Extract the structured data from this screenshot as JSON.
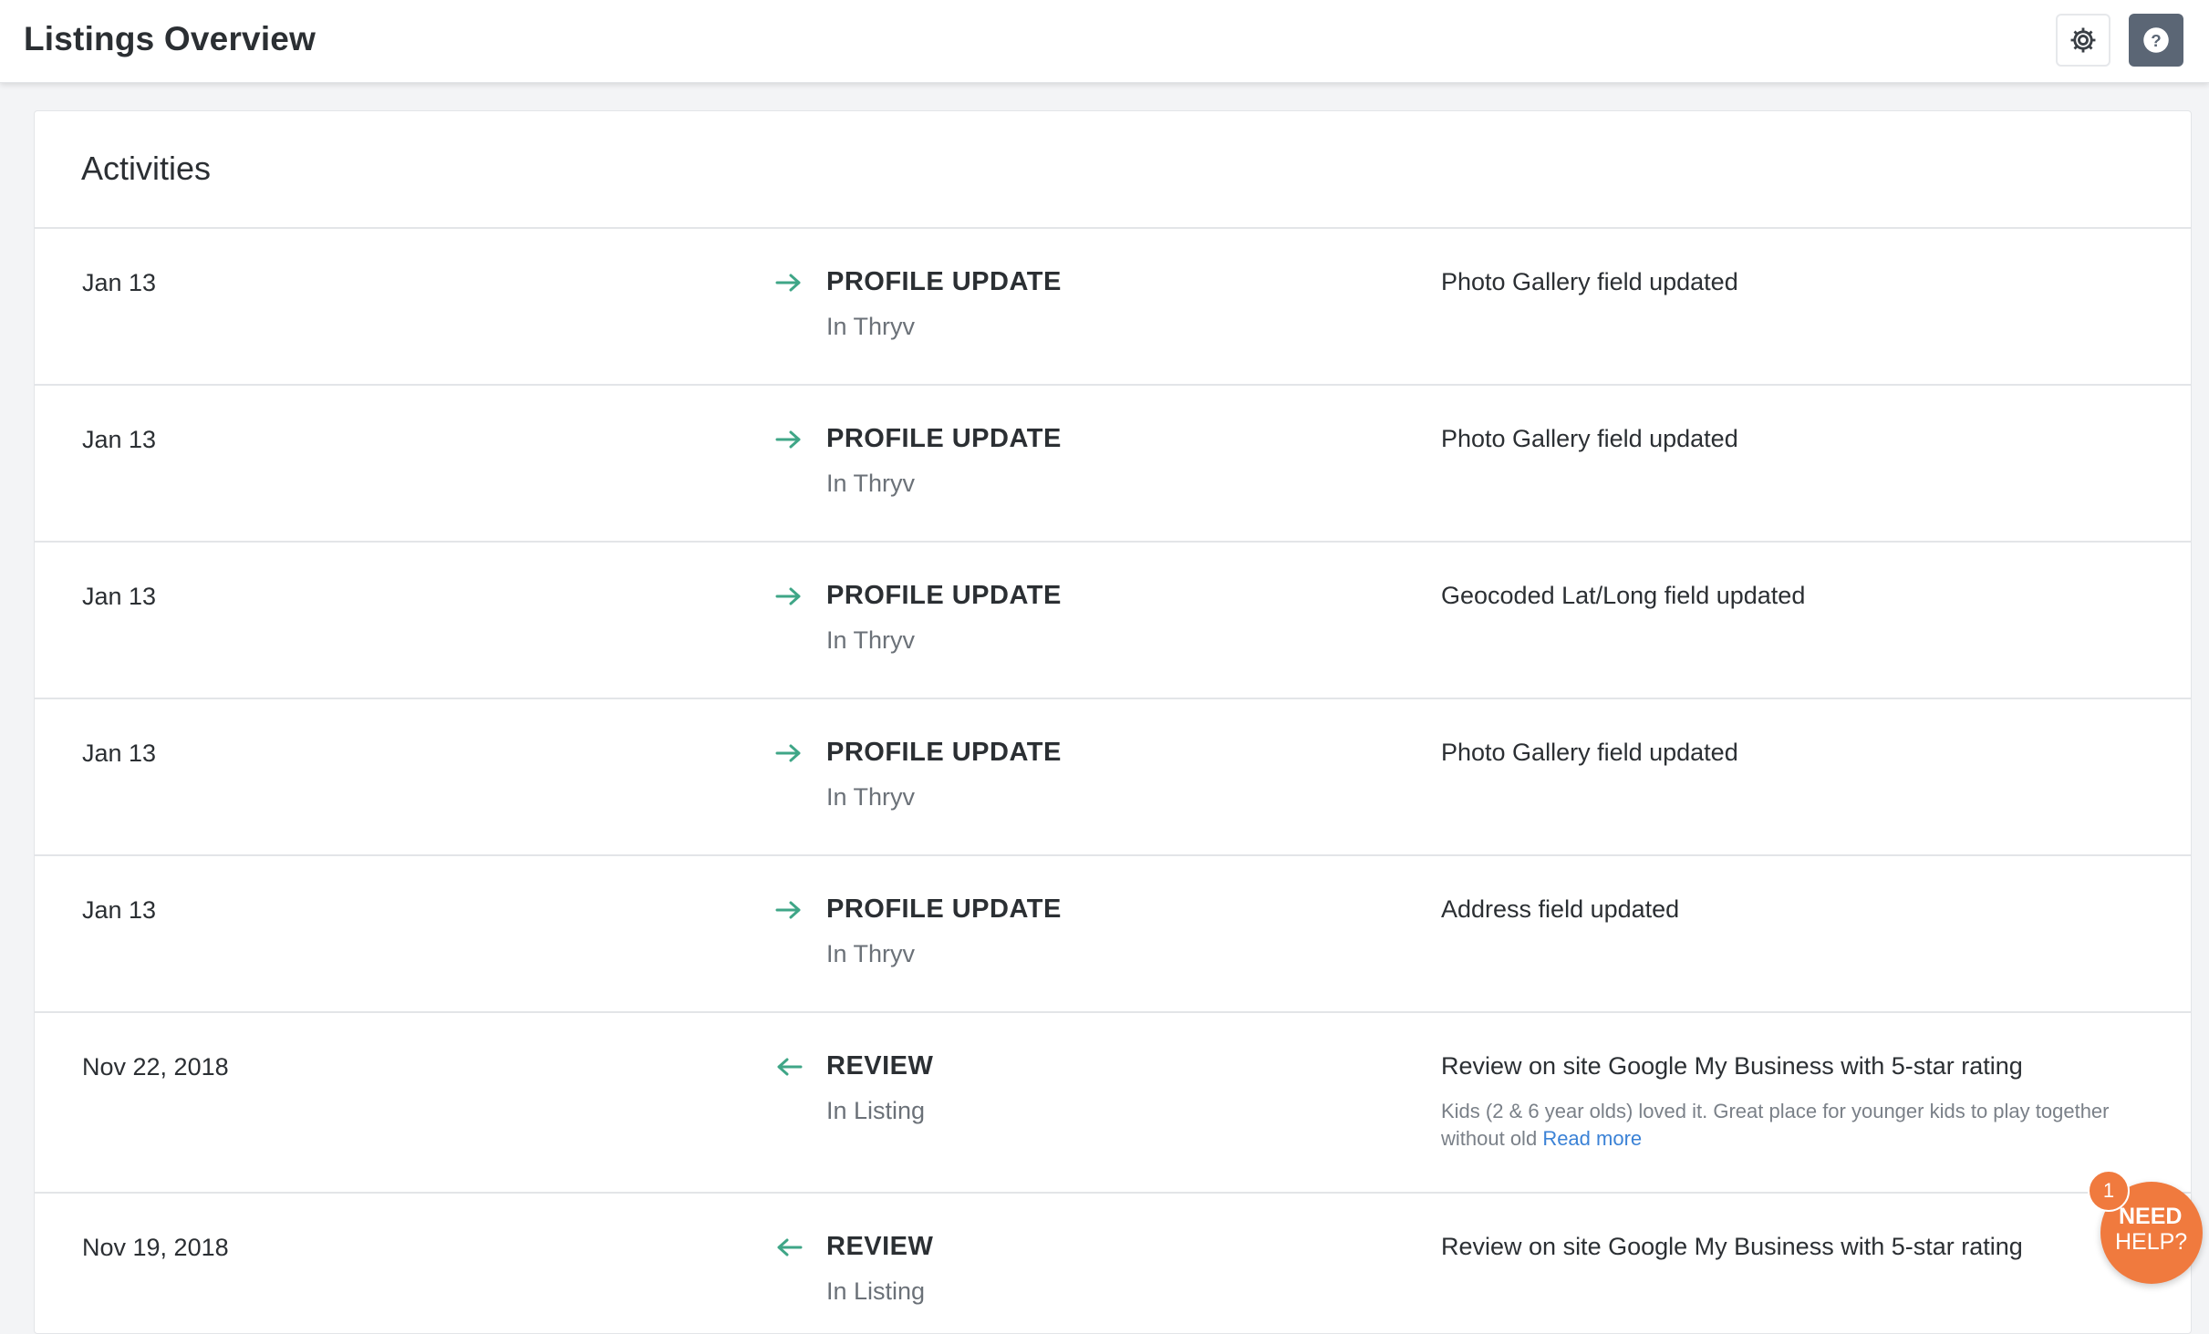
{
  "header": {
    "title": "Listings Overview",
    "settings_icon": "gear-icon",
    "help_icon": "question-circle-icon"
  },
  "activities": {
    "title": "Activities",
    "items": [
      {
        "date": "Jan 13",
        "direction": "outgoing",
        "icon": "arrow-right-icon",
        "type": "PROFILE UPDATE",
        "source": "In Thryv",
        "description": "Photo Gallery field updated"
      },
      {
        "date": "Jan 13",
        "direction": "outgoing",
        "icon": "arrow-right-icon",
        "type": "PROFILE UPDATE",
        "source": "In Thryv",
        "description": "Photo Gallery field updated"
      },
      {
        "date": "Jan 13",
        "direction": "outgoing",
        "icon": "arrow-right-icon",
        "type": "PROFILE UPDATE",
        "source": "In Thryv",
        "description": "Geocoded Lat/Long field updated"
      },
      {
        "date": "Jan 13",
        "direction": "outgoing",
        "icon": "arrow-right-icon",
        "type": "PROFILE UPDATE",
        "source": "In Thryv",
        "description": "Photo Gallery field updated"
      },
      {
        "date": "Jan 13",
        "direction": "outgoing",
        "icon": "arrow-right-icon",
        "type": "PROFILE UPDATE",
        "source": "In Thryv",
        "description": "Address field updated"
      },
      {
        "date": "Nov 22, 2018",
        "direction": "incoming",
        "icon": "arrow-left-icon",
        "type": "REVIEW",
        "source": "In Listing",
        "description": "Review on site Google My Business with 5-star rating",
        "excerpt": "Kids (2 & 6 year olds) loved it. Great place for younger kids to play together without old",
        "read_more": "Read more"
      },
      {
        "date": "Nov 19, 2018",
        "direction": "incoming",
        "icon": "arrow-left-icon",
        "type": "REVIEW",
        "source": "In Listing",
        "description": "Review on site Google My Business with 5-star rating"
      }
    ]
  },
  "need_help": {
    "line1": "NEED",
    "line2": "HELP?",
    "badge_count": "1"
  },
  "colors": {
    "arrow": "#3fa687",
    "need_help": "#f07a3e",
    "link": "#3b82d6",
    "help_button": "#5b6675"
  }
}
